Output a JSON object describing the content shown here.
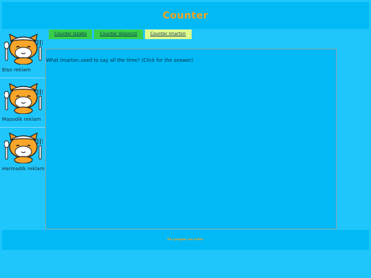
{
  "header": {
    "title": "Counter"
  },
  "sidebar": {
    "items": [
      {
        "label": "Elso reklam",
        "icon": "mascot-icon"
      },
      {
        "label": "Masodik reklam",
        "icon": "mascot-icon"
      },
      {
        "label": "Harmadik reklam",
        "icon": "mascot-icon"
      }
    ]
  },
  "tabs": [
    {
      "label": "Counter Iszabo"
    },
    {
      "label": "Counter Ilosonczi"
    },
    {
      "label": "Counter Imarton"
    }
  ],
  "main": {
    "question": "What Imarton used to say all the time? (Click for the answer)"
  },
  "footer": {
    "text": "For people can enter"
  },
  "colors": {
    "background": "#1fc6fc",
    "panel": "#00b9f5",
    "title": "#f4a41c",
    "tab_green": "#37cf4a",
    "tab_active": "#dffc8e"
  }
}
